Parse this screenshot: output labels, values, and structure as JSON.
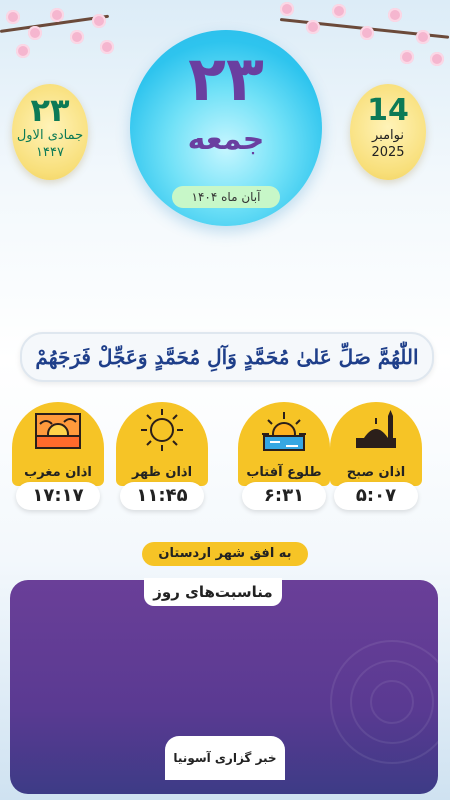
{
  "date": {
    "solar_day": "۲۳",
    "weekday": "جمعه",
    "solar_month_year": "آبان ماه ۱۴۰۴",
    "hijri_day": "۲۳",
    "hijri_month": "جمادی الاول",
    "hijri_year": "۱۴۴۷",
    "greg_day": "14",
    "greg_month": "نوامبر",
    "greg_year": "2025"
  },
  "salawat": "اللّٰهُمَّ صَلِّ عَلیٰ مُحَمَّدٍ وَآلِ مُحَمَّدٍ وَعَجِّلْ فَرَجَهُمْ",
  "prayers": [
    {
      "name": "اذان صبح",
      "time": "۵:۰۷",
      "icon": "mosque-icon"
    },
    {
      "name": "طلوع آفتاب",
      "time": "۶:۳۱",
      "icon": "sunrise-icon"
    },
    {
      "name": "اذان ظهر",
      "time": "۱۱:۴۵",
      "icon": "sun-icon"
    },
    {
      "name": "اذان مغرب",
      "time": "۱۷:۱۷",
      "icon": "sunset-icon"
    }
  ],
  "horizon_label": "به افق شهر اردستان",
  "occasions": {
    "title": "مناسبت‌های روز",
    "agency": "خبر گزاری آسونیا"
  },
  "colors": {
    "accent_yellow": "#f6c426",
    "badge_cyan": "#2ec4ee",
    "purple": "#6a3fa0",
    "green": "#0d7a56"
  }
}
